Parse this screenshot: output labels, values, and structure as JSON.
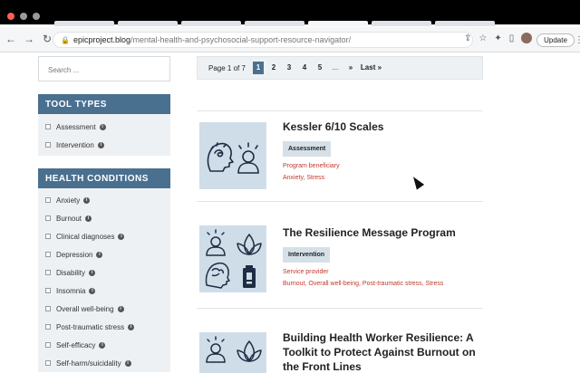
{
  "browser": {
    "url_host": "epicproject.blog",
    "url_path": "/mental-health-and-psychosocial-support-resource-navigator/",
    "update_label": "Update"
  },
  "sidebar": {
    "search_placeholder": "Search ...",
    "tool_types": {
      "heading": "TOOL TYPES",
      "items": [
        "Assessment",
        "Intervention"
      ]
    },
    "health_conditions": {
      "heading": "HEALTH CONDITIONS",
      "items": [
        "Anxiety",
        "Burnout",
        "Clinical diagnoses",
        "Depression",
        "Disability",
        "Insomnia",
        "Overall well-being",
        "Post-traumatic stress",
        "Self-efficacy",
        "Self-harm/suicidality"
      ]
    }
  },
  "pager": {
    "label": "Page 1 of 7",
    "pages": [
      "1",
      "2",
      "3",
      "4",
      "5"
    ],
    "ellipsis": "...",
    "next": "»",
    "last": "Last »"
  },
  "results": [
    {
      "title": "Kessler 6/10 Scales",
      "tag": "Assessment",
      "audience": "Program beneficiary",
      "conditions": "Anxiety, Stress",
      "icons": [
        "anxious-head-icon",
        "stressed-person-icon"
      ]
    },
    {
      "title": "The Resilience Message Program",
      "tag": "Intervention",
      "audience": "Service provider",
      "conditions": "Burnout, Overall well-being, Post-traumatic stress, Stress",
      "icons": [
        "stressed-person-icon",
        "leaf-icon",
        "brain-head-icon",
        "low-battery-icon"
      ]
    },
    {
      "title": "Building Health Worker Resilience: A Toolkit to Protect Against Burnout on the Front Lines",
      "icons": [
        "stressed-person-icon",
        "leaf-icon"
      ]
    }
  ],
  "colors": {
    "accent": "#4a7090",
    "tag_bg": "#d5e0e8",
    "meta_red": "#c0392b",
    "thumb_bg": "#cfdde8",
    "icon_navy": "#1f2d44"
  }
}
